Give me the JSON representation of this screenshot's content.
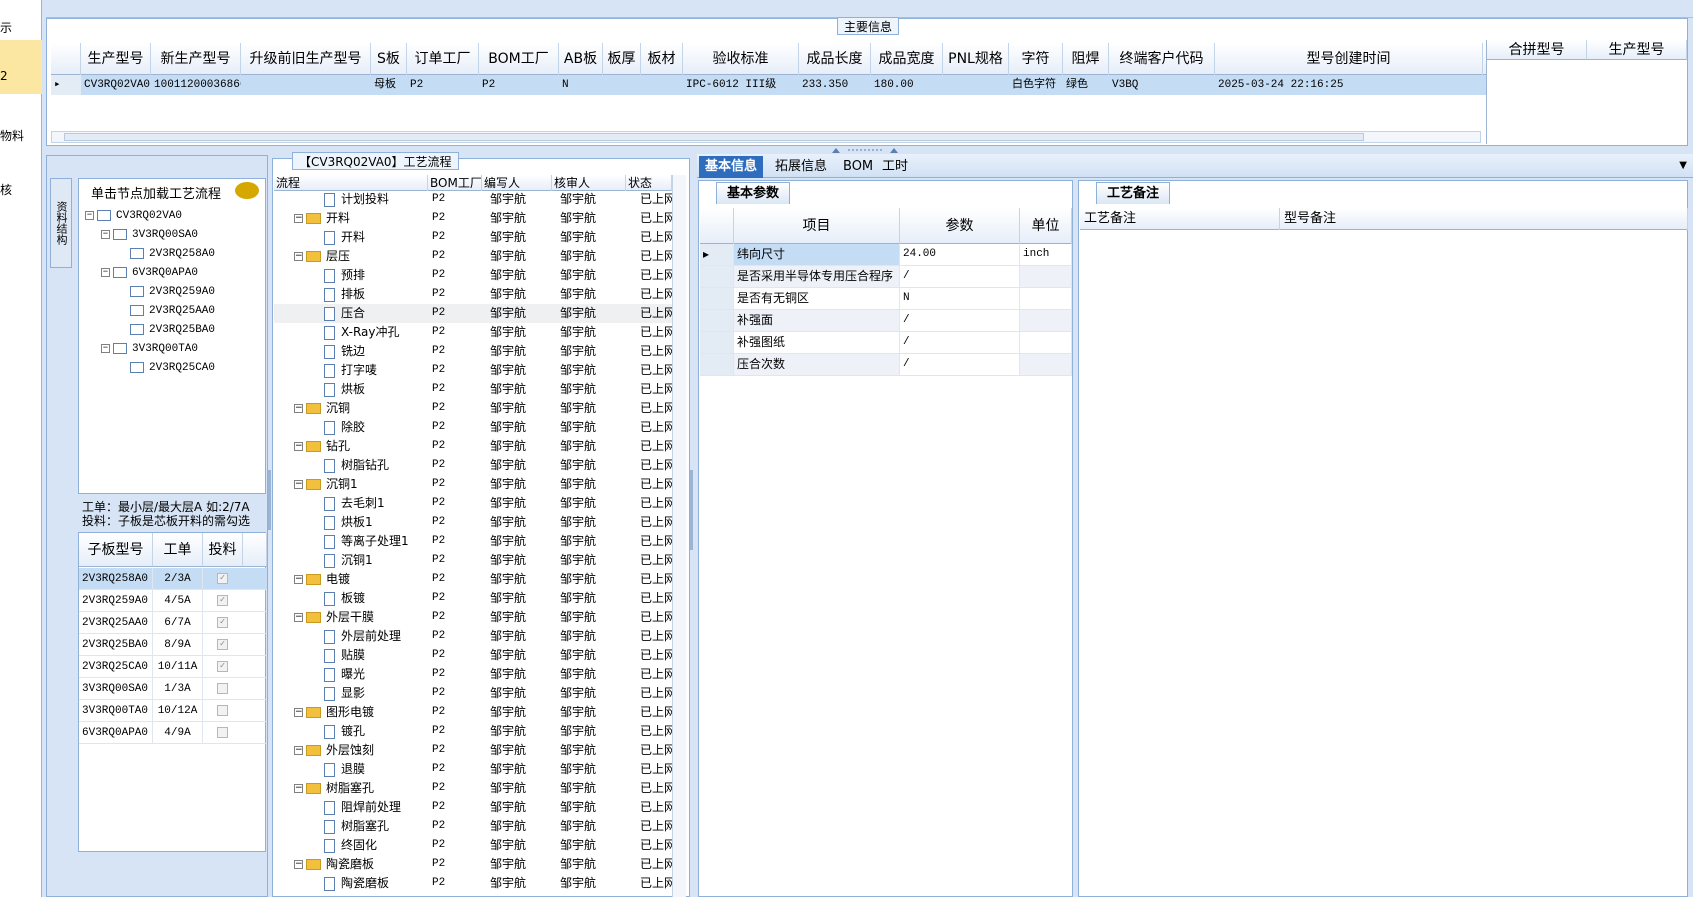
{
  "nav": {
    "items": [
      "示",
      "2",
      "物料",
      "核"
    ]
  },
  "main_info": {
    "title": "主要信息",
    "columns": [
      "生产型号",
      "新生产型号",
      "升级前旧生产型号",
      "S板",
      "订单工厂",
      "BOM工厂",
      "AB板",
      "板厚",
      "板材",
      "验收标准",
      "成品长度",
      "成品宽度",
      "PNL规格",
      "字符",
      "阻焊",
      "终端客户代码",
      "型号创建时间"
    ],
    "row": [
      "CV3RQ02VA0",
      "10011200036866",
      "",
      "母板",
      "P2",
      "P2",
      "N",
      "",
      "",
      "IPC-6012 III级",
      "233.350",
      "180.00",
      "",
      "白色字符",
      "绿色",
      "V3BQ",
      "2025-03-24 22:16:25"
    ],
    "merge_columns": [
      "合拼型号",
      "生产型号"
    ]
  },
  "left": {
    "side_tab": "资料结构",
    "hint": "单击节点加载工艺流程",
    "tree": [
      {
        "label": "CV3RQ02VA0",
        "level": 0
      },
      {
        "label": "3V3RQ00SA0",
        "level": 1
      },
      {
        "label": "2V3RQ258A0",
        "level": 2
      },
      {
        "label": "6V3RQ0APA0",
        "level": 1
      },
      {
        "label": "2V3RQ259A0",
        "level": 2
      },
      {
        "label": "2V3RQ25AA0",
        "level": 2
      },
      {
        "label": "2V3RQ25BA0",
        "level": 2
      },
      {
        "label": "3V3RQ00TA0",
        "level": 1
      },
      {
        "label": "2V3RQ25CA0",
        "level": 2
      }
    ],
    "note1": "工单：最小层/最大层A 如:2/7A",
    "note2": "投料：子板是芯板开料的需勾选",
    "sub_columns": [
      "子板型号",
      "工单",
      "投料"
    ],
    "sub_rows": [
      {
        "model": "2V3RQ258A0",
        "order": "2/3A",
        "checked": true
      },
      {
        "model": "2V3RQ259A0",
        "order": "4/5A",
        "checked": true
      },
      {
        "model": "2V3RQ25AA0",
        "order": "6/7A",
        "checked": true
      },
      {
        "model": "2V3RQ25BA0",
        "order": "8/9A",
        "checked": true
      },
      {
        "model": "2V3RQ25CA0",
        "order": "10/11A",
        "checked": true
      },
      {
        "model": "3V3RQ00SA0",
        "order": "1/3A",
        "checked": false
      },
      {
        "model": "3V3RQ00TA0",
        "order": "10/12A",
        "checked": false
      },
      {
        "model": "6V3RQ0APA0",
        "order": "4/9A",
        "checked": false
      }
    ]
  },
  "process": {
    "title": "【CV3RQ02VA0】工艺流程",
    "columns": [
      "流程",
      "BOM工厂",
      "编写人",
      "核审人",
      "状态"
    ],
    "rows": [
      {
        "name": "计划投料",
        "type": "doc"
      },
      {
        "name": "开料",
        "type": "folder"
      },
      {
        "name": "开料",
        "type": "doc"
      },
      {
        "name": "层压",
        "type": "folder"
      },
      {
        "name": "预排",
        "type": "doc"
      },
      {
        "name": "排板",
        "type": "doc"
      },
      {
        "name": "压合",
        "type": "doc"
      },
      {
        "name": "X-Ray冲孔",
        "type": "doc"
      },
      {
        "name": "铣边",
        "type": "doc"
      },
      {
        "name": "打字唛",
        "type": "doc"
      },
      {
        "name": "烘板",
        "type": "doc"
      },
      {
        "name": "沉铜",
        "type": "folder"
      },
      {
        "name": "除胶",
        "type": "doc"
      },
      {
        "name": "钻孔",
        "type": "folder"
      },
      {
        "name": "树脂钻孔",
        "type": "doc"
      },
      {
        "name": "沉铜1",
        "type": "folder"
      },
      {
        "name": "去毛刺1",
        "type": "doc"
      },
      {
        "name": "烘板1",
        "type": "doc"
      },
      {
        "name": "等离子处理1",
        "type": "doc"
      },
      {
        "name": "沉铜1",
        "type": "doc"
      },
      {
        "name": "电镀",
        "type": "folder"
      },
      {
        "name": "板镀",
        "type": "doc"
      },
      {
        "name": "外层干膜",
        "type": "folder"
      },
      {
        "name": "外层前处理",
        "type": "doc"
      },
      {
        "name": "贴膜",
        "type": "doc"
      },
      {
        "name": "曝光",
        "type": "doc"
      },
      {
        "name": "显影",
        "type": "doc"
      },
      {
        "name": "图形电镀",
        "type": "folder"
      },
      {
        "name": "镀孔",
        "type": "doc"
      },
      {
        "name": "外层蚀刻",
        "type": "folder"
      },
      {
        "name": "退膜",
        "type": "doc"
      },
      {
        "name": "树脂塞孔",
        "type": "folder"
      },
      {
        "name": "阻焊前处理",
        "type": "doc"
      },
      {
        "name": "树脂塞孔",
        "type": "doc"
      },
      {
        "name": "终固化",
        "type": "doc"
      },
      {
        "name": "陶瓷磨板",
        "type": "folder"
      },
      {
        "name": "陶瓷磨板",
        "type": "doc"
      }
    ],
    "bom": "P2",
    "writer": "邹宇航",
    "reviewer": "邹宇航",
    "status": "已上网"
  },
  "right": {
    "tabs": [
      "基本信息",
      "拓展信息",
      "BOM",
      "工时"
    ],
    "basic_tab": "基本参数",
    "param_columns": [
      "项目",
      "参数",
      "单位"
    ],
    "params": [
      {
        "item": "纬向尺寸",
        "value": "24.00",
        "unit": "inch"
      },
      {
        "item": "是否采用半导体专用压合程序",
        "value": "/",
        "unit": ""
      },
      {
        "item": "是否有无铜区",
        "value": "N",
        "unit": ""
      },
      {
        "item": "补强面",
        "value": "/",
        "unit": ""
      },
      {
        "item": "补强图纸",
        "value": "/",
        "unit": ""
      },
      {
        "item": "压合次数",
        "value": "/",
        "unit": ""
      }
    ],
    "notes_tab": "工艺备注",
    "notes_columns": [
      "工艺备注",
      "型号备注"
    ]
  }
}
